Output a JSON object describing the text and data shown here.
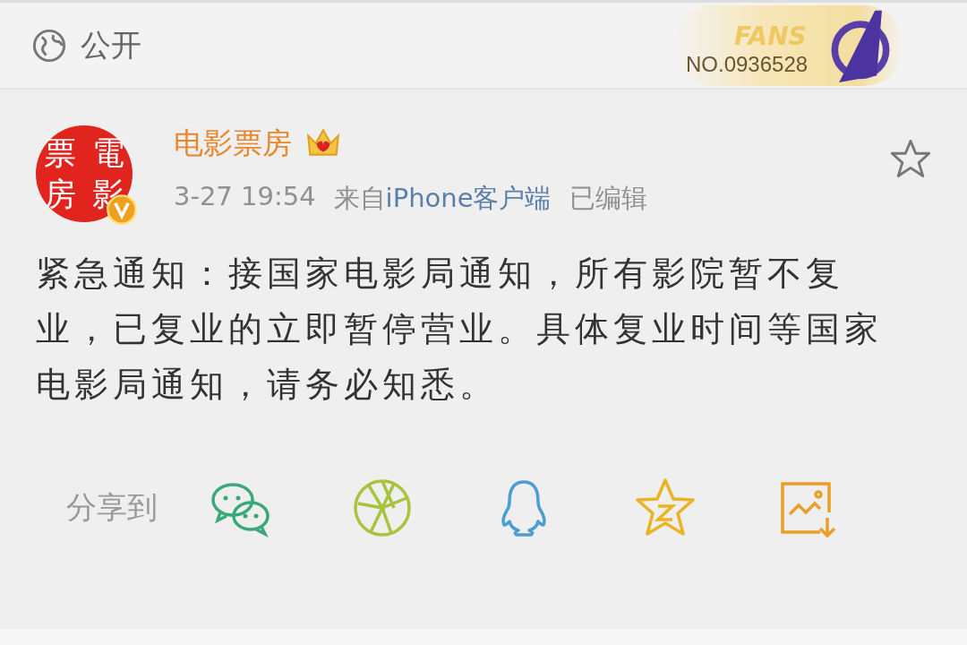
{
  "top_bar": {
    "visibility": "公开",
    "badge": {
      "title": "FANS",
      "number": "NO.0936528"
    }
  },
  "post": {
    "author": {
      "name": "电影票房",
      "avatar_chars": [
        "票",
        "電",
        "房",
        "影"
      ],
      "verified": true,
      "crown": true
    },
    "starred": false,
    "time": "3-27 19:54",
    "source_prefix": "来自",
    "source": "iPhone客户端",
    "edited": "已编辑",
    "text": "紧急通知：接国家电影局通知，所有影院暂不复业，已复业的立即暂停营业。具体复业时间等国家电影局通知，请务必知悉。"
  },
  "share": {
    "label": "分享到",
    "targets": [
      {
        "kind": "wechat",
        "color": "#3ba87a"
      },
      {
        "kind": "moments",
        "color": "#a8c43c"
      },
      {
        "kind": "qq",
        "color": "#4a9fd0"
      },
      {
        "kind": "qzone",
        "color": "#e8b423"
      },
      {
        "kind": "save",
        "color": "#e8a02a"
      }
    ]
  }
}
